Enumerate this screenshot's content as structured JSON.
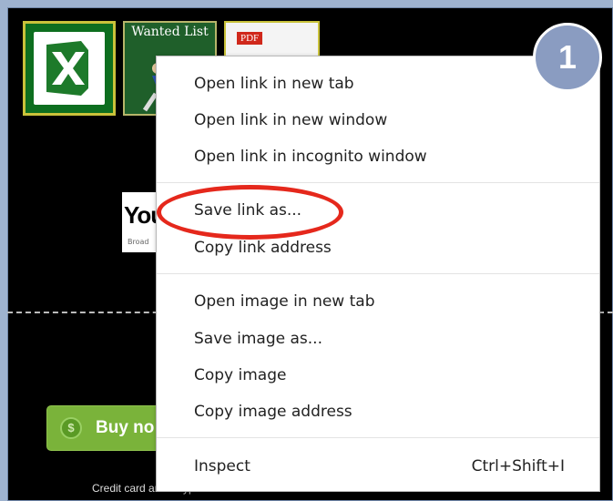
{
  "thumbnails": {
    "wanted_list_label": "Wanted List",
    "pdf_label": "PDF",
    "youtube_label": "You",
    "youtube_sub": "Broad"
  },
  "page": {
    "buy_label": "Buy no",
    "payment_text": "Credit card and Paypal"
  },
  "menu": {
    "open_new_tab": "Open link in new tab",
    "open_new_window": "Open link in new window",
    "open_incognito": "Open link in incognito window",
    "save_link_as": "Save link as...",
    "copy_link": "Copy link address",
    "open_image_tab": "Open image in new tab",
    "save_image_as": "Save image as...",
    "copy_image": "Copy image",
    "copy_image_address": "Copy image address",
    "inspect": "Inspect",
    "inspect_shortcut": "Ctrl+Shift+I"
  },
  "annotation": {
    "step_number": "1",
    "highlight_color": "#e5281c",
    "badge_color": "#8a9cc1"
  },
  "colors": {
    "page_background": "#000000",
    "buy_button": "#7ab33a"
  },
  "icons": [
    "excel-icon",
    "runner-image",
    "pdf-icon",
    "dollar-icon"
  ]
}
